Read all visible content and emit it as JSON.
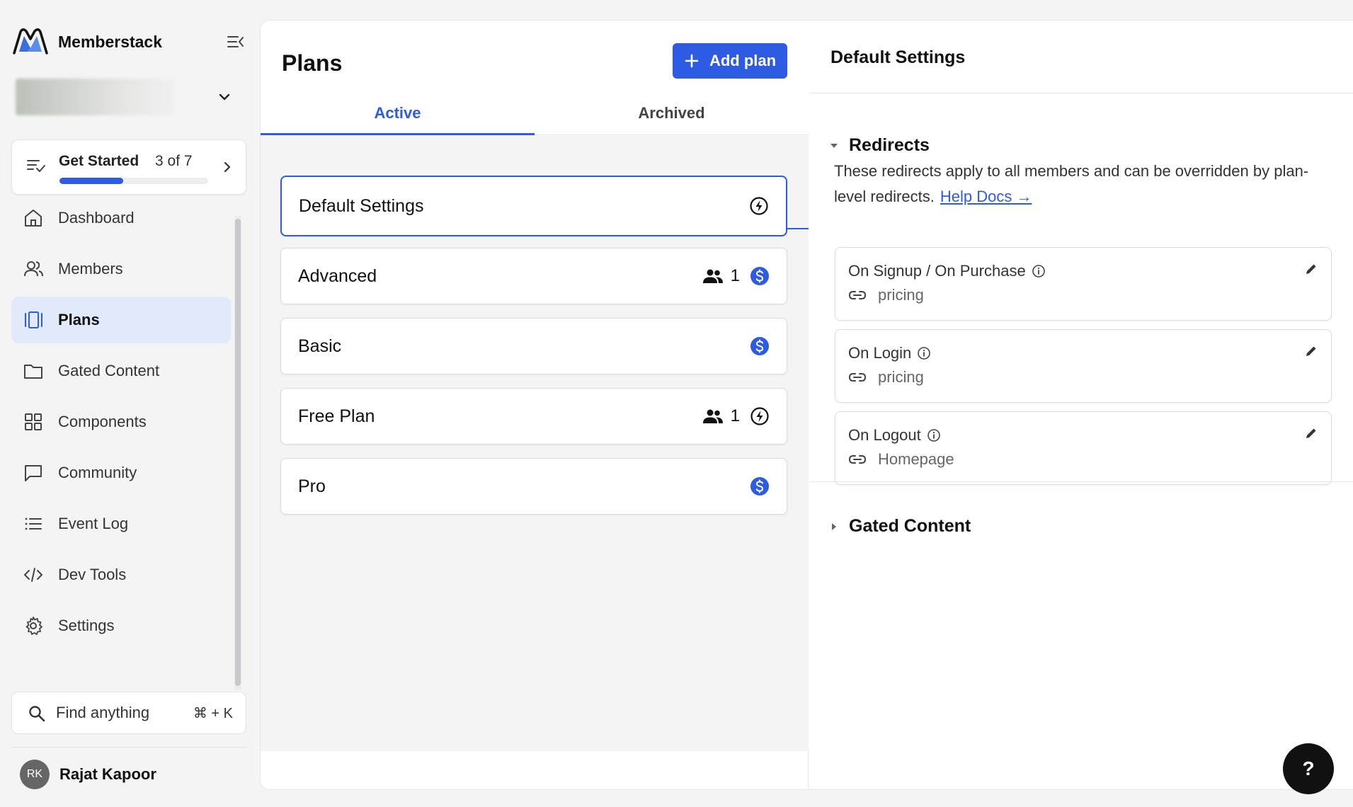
{
  "brand": {
    "name": "Memberstack"
  },
  "get_started": {
    "title": "Get Started",
    "count": "3 of 7",
    "progress": 0.43
  },
  "nav": {
    "items": [
      {
        "label": "Dashboard",
        "icon": "home-icon"
      },
      {
        "label": "Members",
        "icon": "members-icon"
      },
      {
        "label": "Plans",
        "icon": "plans-icon",
        "active": true
      },
      {
        "label": "Gated Content",
        "icon": "folder-icon"
      },
      {
        "label": "Components",
        "icon": "grid-icon"
      },
      {
        "label": "Community",
        "icon": "chat-icon"
      },
      {
        "label": "Event Log",
        "icon": "list-icon"
      },
      {
        "label": "Dev Tools",
        "icon": "code-icon"
      },
      {
        "label": "Settings",
        "icon": "gear-icon"
      }
    ]
  },
  "search": {
    "placeholder": "Find anything",
    "shortcut": "⌘ + K"
  },
  "user": {
    "initials": "RK",
    "name": "Rajat Kapoor"
  },
  "plans": {
    "title": "Plans",
    "add_label": "Add plan",
    "tabs": [
      {
        "label": "Active",
        "active": true
      },
      {
        "label": "Archived"
      }
    ],
    "items": [
      {
        "name": "Default Settings",
        "members": null,
        "type": "free",
        "selected": true
      },
      {
        "name": "Advanced",
        "members": "1",
        "type": "paid"
      },
      {
        "name": "Basic",
        "members": null,
        "type": "paid"
      },
      {
        "name": "Free Plan",
        "members": "1",
        "type": "free"
      },
      {
        "name": "Pro",
        "members": null,
        "type": "paid"
      }
    ]
  },
  "details": {
    "title": "Default Settings",
    "redirects": {
      "title": "Redirects",
      "description": "These redirects apply to all members and can be overridden by plan-level redirects.",
      "help_link": "Help Docs →",
      "items": [
        {
          "label": "On Signup / On Purchase",
          "value": "pricing"
        },
        {
          "label": "On Login",
          "value": "pricing"
        },
        {
          "label": "On Logout",
          "value": "Homepage"
        }
      ]
    },
    "gated_content": {
      "title": "Gated Content"
    }
  },
  "help_button": {
    "label": "?"
  },
  "colors": {
    "accent": "#2d5be3",
    "active_nav_bg": "#e0eafb",
    "panel_bg": "#f4f4f5"
  }
}
